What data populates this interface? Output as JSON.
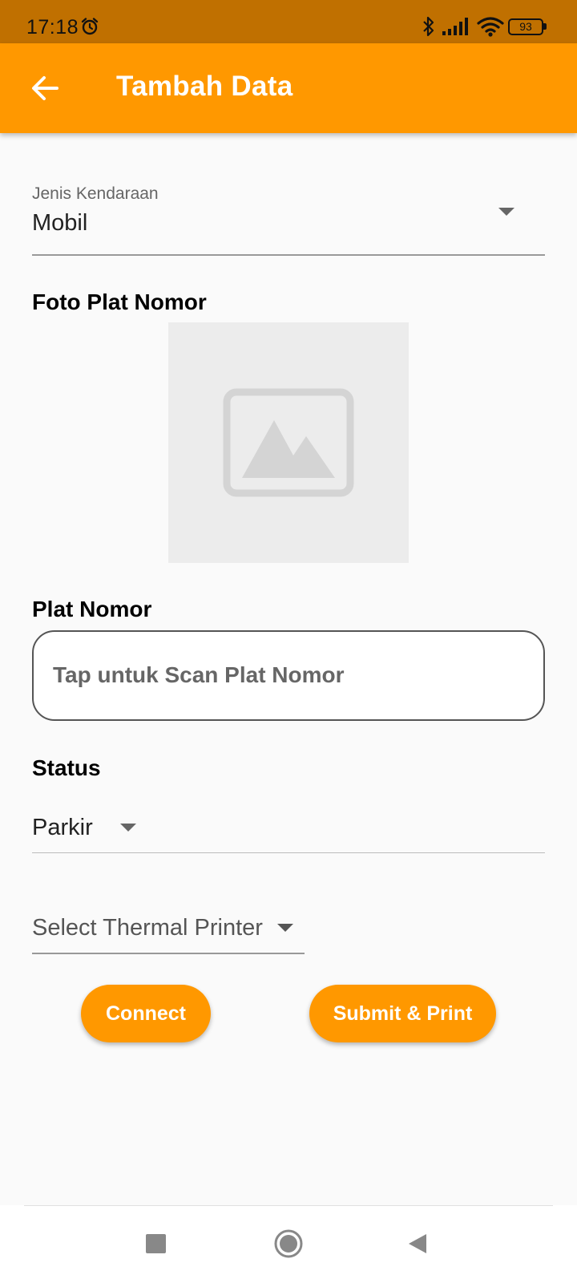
{
  "status_bar": {
    "time": "17:18",
    "battery": "93",
    "icons": [
      "alarm-icon",
      "bluetooth-icon",
      "signal-icon",
      "wifi-icon",
      "battery-icon"
    ]
  },
  "app_bar": {
    "title": "Tambah Data",
    "back_icon": "arrow-left-icon",
    "color": "#ff9800"
  },
  "vehicle_type": {
    "label": "Jenis Kendaraan",
    "value": "Mobil"
  },
  "photo": {
    "label": "Foto Plat Nomor",
    "placeholder_icon": "image-placeholder-icon"
  },
  "plate": {
    "label": "Plat Nomor",
    "placeholder": "Tap untuk Scan Plat Nomor"
  },
  "status": {
    "label": "Status",
    "value": "Parkir"
  },
  "printer": {
    "placeholder": "Select Thermal Printer"
  },
  "actions": {
    "connect_label": "Connect",
    "submit_label": "Submit & Print"
  },
  "nav": {
    "icons": [
      "recents-icon",
      "home-icon",
      "back-icon"
    ]
  },
  "colors": {
    "primary": "#ff9800",
    "status_bar": "#c07000",
    "background": "#fafafa"
  }
}
